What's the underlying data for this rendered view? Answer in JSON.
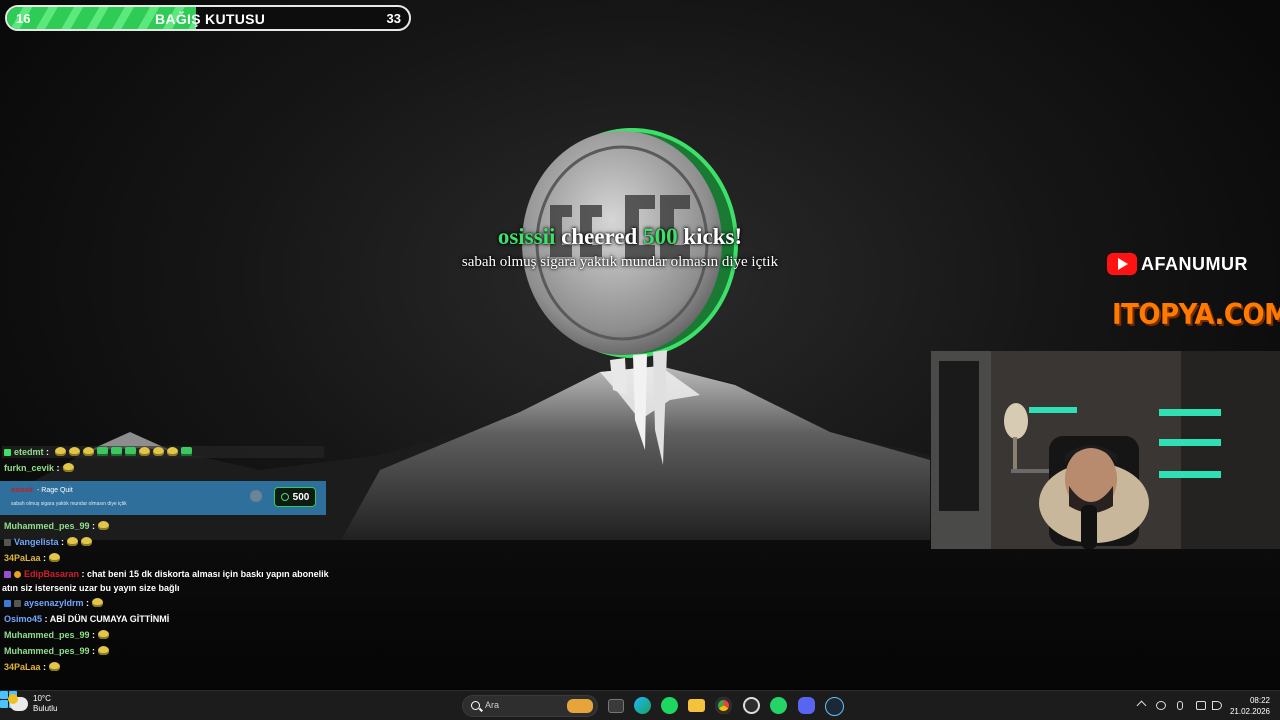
{
  "donation": {
    "min": "16",
    "title": "BAĞIŞ KUTUSU",
    "max": "33",
    "progress_fraction": 0.47
  },
  "alert": {
    "username": "osissii",
    "action": "cheered",
    "amount": "500",
    "unit": "kicks!",
    "message": "sabah olmuş sigara yaktık mundar olmasın diye içtik"
  },
  "branding": {
    "youtube_channel": "AFANUMUR",
    "sponsor_logo": "ITOPYA.COM"
  },
  "chat": {
    "messages": [
      {
        "user": "etedmt",
        "color": "#8fe08a",
        "text": "",
        "emotes": 10
      },
      {
        "user": "furkn_cevik",
        "color": "#8fe08a",
        "text": "",
        "emotes": 1
      },
      {
        "user": "Muhammed_pes_99",
        "color": "#8fe08a",
        "text": "",
        "emotes": 1
      },
      {
        "user": "Vangelista",
        "color": "#6fa8ff",
        "text": "",
        "emotes": 2
      },
      {
        "user": "34PaLaa",
        "color": "#e2b43a",
        "text": "",
        "emotes": 1
      },
      {
        "user": "EdipBasaran",
        "color": "#d21d2f",
        "text": "chat beni 15 dk diskorta alması için baskı yapın abonelik",
        "emotes": 0
      },
      {
        "user": "",
        "color": "#ffffff",
        "text": "atın siz isterseniz uzar bu yayın size bağlı",
        "emotes": 0
      },
      {
        "user": "aysenazyldrm",
        "color": "#6fa8ff",
        "text": "",
        "emotes": 1
      },
      {
        "user": "Osimo45",
        "color": "#6fa8ff",
        "text": "ABİ DÜN CUMAYA GİTTİNMİ",
        "emotes": 0
      },
      {
        "user": "Muhammed_pes_99",
        "color": "#8fe08a",
        "text": "",
        "emotes": 1
      },
      {
        "user": "Muhammed_pes_99",
        "color": "#8fe08a",
        "text": "",
        "emotes": 1
      },
      {
        "user": "34PaLaa",
        "color": "#e2b43a",
        "text": "",
        "emotes": 1
      }
    ],
    "cheer_card": {
      "user": "osissii",
      "reward": "- Rage Quit",
      "text": "sabah olmuş sigara yaktık mundar olmasın diye içtik",
      "amount": "500"
    }
  },
  "taskbar": {
    "weather_temp": "10°C",
    "weather_desc": "Bulutlu",
    "search_placeholder": "Ara",
    "time": "08:22",
    "date": "21.02.2026",
    "pinned_apps": [
      "windows-start-icon",
      "task-view-icon",
      "edge-icon",
      "spotify-icon",
      "file-explorer-icon",
      "chrome-icon",
      "obs-icon",
      "whatsapp-icon",
      "discord-icon",
      "steam-icon"
    ]
  },
  "colors": {
    "kick_green": "#3fe06a",
    "cheer_card_bg": "#2f6f9c",
    "youtube_red": "#ff1212",
    "itopya_orange": "#ff7a00"
  }
}
